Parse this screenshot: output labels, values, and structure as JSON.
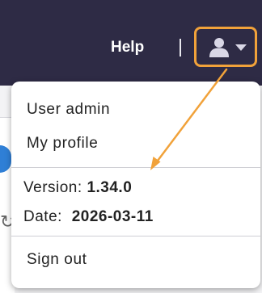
{
  "header": {
    "help_label": "Help",
    "user_menu": {
      "icon": "user-icon",
      "dropdown_icon": "caret-down-icon",
      "highlight_color": "#f1a23a"
    }
  },
  "dropdown": {
    "items": [
      {
        "label": "User admin"
      },
      {
        "label": "My profile"
      }
    ],
    "info": {
      "version_label": "Version:",
      "version_value": "1.34.0",
      "date_label": "Date:",
      "date_value": "2026-03-11"
    },
    "sign_out_label": "Sign out"
  },
  "colors": {
    "topbar": "#2e2b45",
    "annotation": "#f1a23a"
  }
}
